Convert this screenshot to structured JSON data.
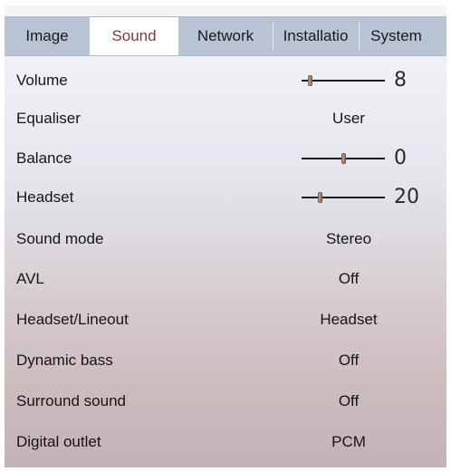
{
  "tabs": [
    {
      "label": "Image",
      "active": false
    },
    {
      "label": "Sound",
      "active": true
    },
    {
      "label": "Network",
      "active": false
    },
    {
      "label": "Installatio",
      "active": false
    },
    {
      "label": "System",
      "active": false
    }
  ],
  "settings": [
    {
      "label": "Volume",
      "type": "slider",
      "value": "8",
      "level": 0.1
    },
    {
      "label": "Equaliser",
      "type": "option",
      "value": "User"
    },
    {
      "label": "Balance",
      "type": "slider",
      "value": "0",
      "level": 0.5
    },
    {
      "label": "Headset",
      "type": "slider",
      "value": "20",
      "level": 0.22
    },
    {
      "label": "Sound mode",
      "type": "option",
      "value": "Stereo"
    },
    {
      "label": "AVL",
      "type": "option",
      "value": "Off"
    },
    {
      "label": "Headset/Lineout",
      "type": "option",
      "value": "Headset"
    },
    {
      "label": "Dynamic bass",
      "type": "option",
      "value": "Off"
    },
    {
      "label": "Surround sound",
      "type": "option",
      "value": "Off"
    },
    {
      "label": "Digital outlet",
      "type": "option",
      "value": "PCM"
    }
  ],
  "colors": {
    "tab_bar": "#b8c3d4",
    "active_tab_text": "#7a3d3a",
    "slider_thumb": "#b08b7d"
  }
}
